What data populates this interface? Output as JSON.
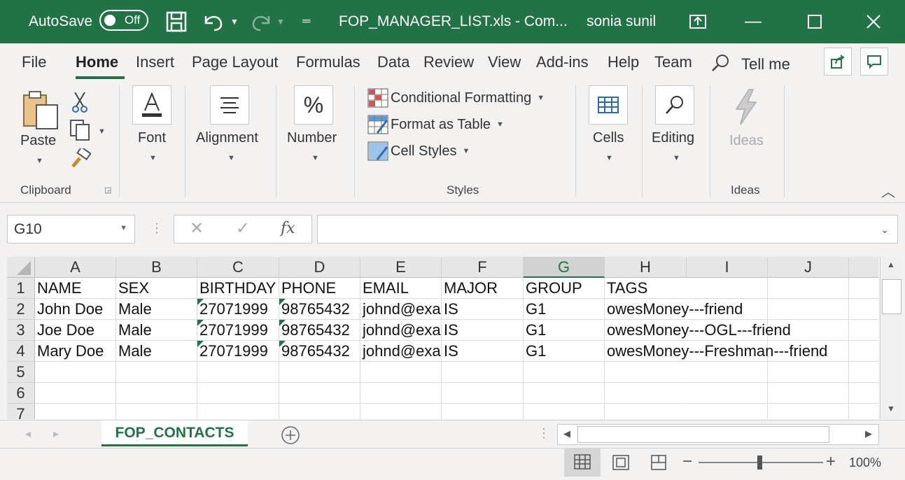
{
  "titlebar": {
    "autosave_label": "AutoSave",
    "autosave_state": "Off",
    "filename": "FOP_MANAGER_LIST.xls  -  Com...",
    "user": "sonia sunil"
  },
  "tabs": [
    "File",
    "Home",
    "Insert",
    "Page Layout",
    "Formulas",
    "Data",
    "Review",
    "View",
    "Add-ins",
    "Help",
    "Team"
  ],
  "tell_me": "Tell me",
  "ribbon": {
    "clipboard": {
      "paste": "Paste",
      "label": "Clipboard"
    },
    "font": "Font",
    "alignment": "Alignment",
    "number": "Number",
    "styles": {
      "conditional": "Conditional Formatting",
      "format_table": "Format as Table",
      "cell_styles": "Cell Styles",
      "label": "Styles"
    },
    "cells": "Cells",
    "editing": "Editing",
    "ideas": {
      "button": "Ideas",
      "label": "Ideas"
    }
  },
  "formula_bar": {
    "name_box": "G10",
    "fx": "fx",
    "value": ""
  },
  "columns": [
    "A",
    "B",
    "C",
    "D",
    "E",
    "F",
    "G",
    "H",
    "I",
    "J"
  ],
  "selected_column": "G",
  "rows": [
    {
      "num": "1",
      "cells": [
        "NAME",
        "SEX",
        "BIRTHDAY",
        "PHONE",
        "EMAIL",
        "MAJOR",
        "GROUP",
        "TAGS"
      ]
    },
    {
      "num": "2",
      "cells": [
        "John Doe",
        "Male",
        "27071999",
        "98765432",
        "johnd@example.com",
        "IS",
        "G1",
        "owesMoney---friend"
      ]
    },
    {
      "num": "3",
      "cells": [
        "Joe Doe",
        "Male",
        "27071999",
        "98765432",
        "johnd@example.com",
        "IS",
        "G1",
        "owesMoney---OGL---friend"
      ]
    },
    {
      "num": "4",
      "cells": [
        "Mary Doe",
        "Male",
        "27071999",
        "98765432",
        "johnd@example.com",
        "IS",
        "G1",
        "owesMoney---Freshman---friend"
      ]
    },
    {
      "num": "5",
      "cells": [
        "",
        "",
        "",
        "",
        "",
        "",
        "",
        ""
      ]
    },
    {
      "num": "6",
      "cells": [
        "",
        "",
        "",
        "",
        "",
        "",
        "",
        ""
      ]
    },
    {
      "num": "7",
      "cells": [
        "",
        "",
        "",
        "",
        "",
        "",
        "",
        ""
      ]
    }
  ],
  "sheet_tab": "FOP_CONTACTS",
  "zoom": "100%",
  "accent": "#217346"
}
